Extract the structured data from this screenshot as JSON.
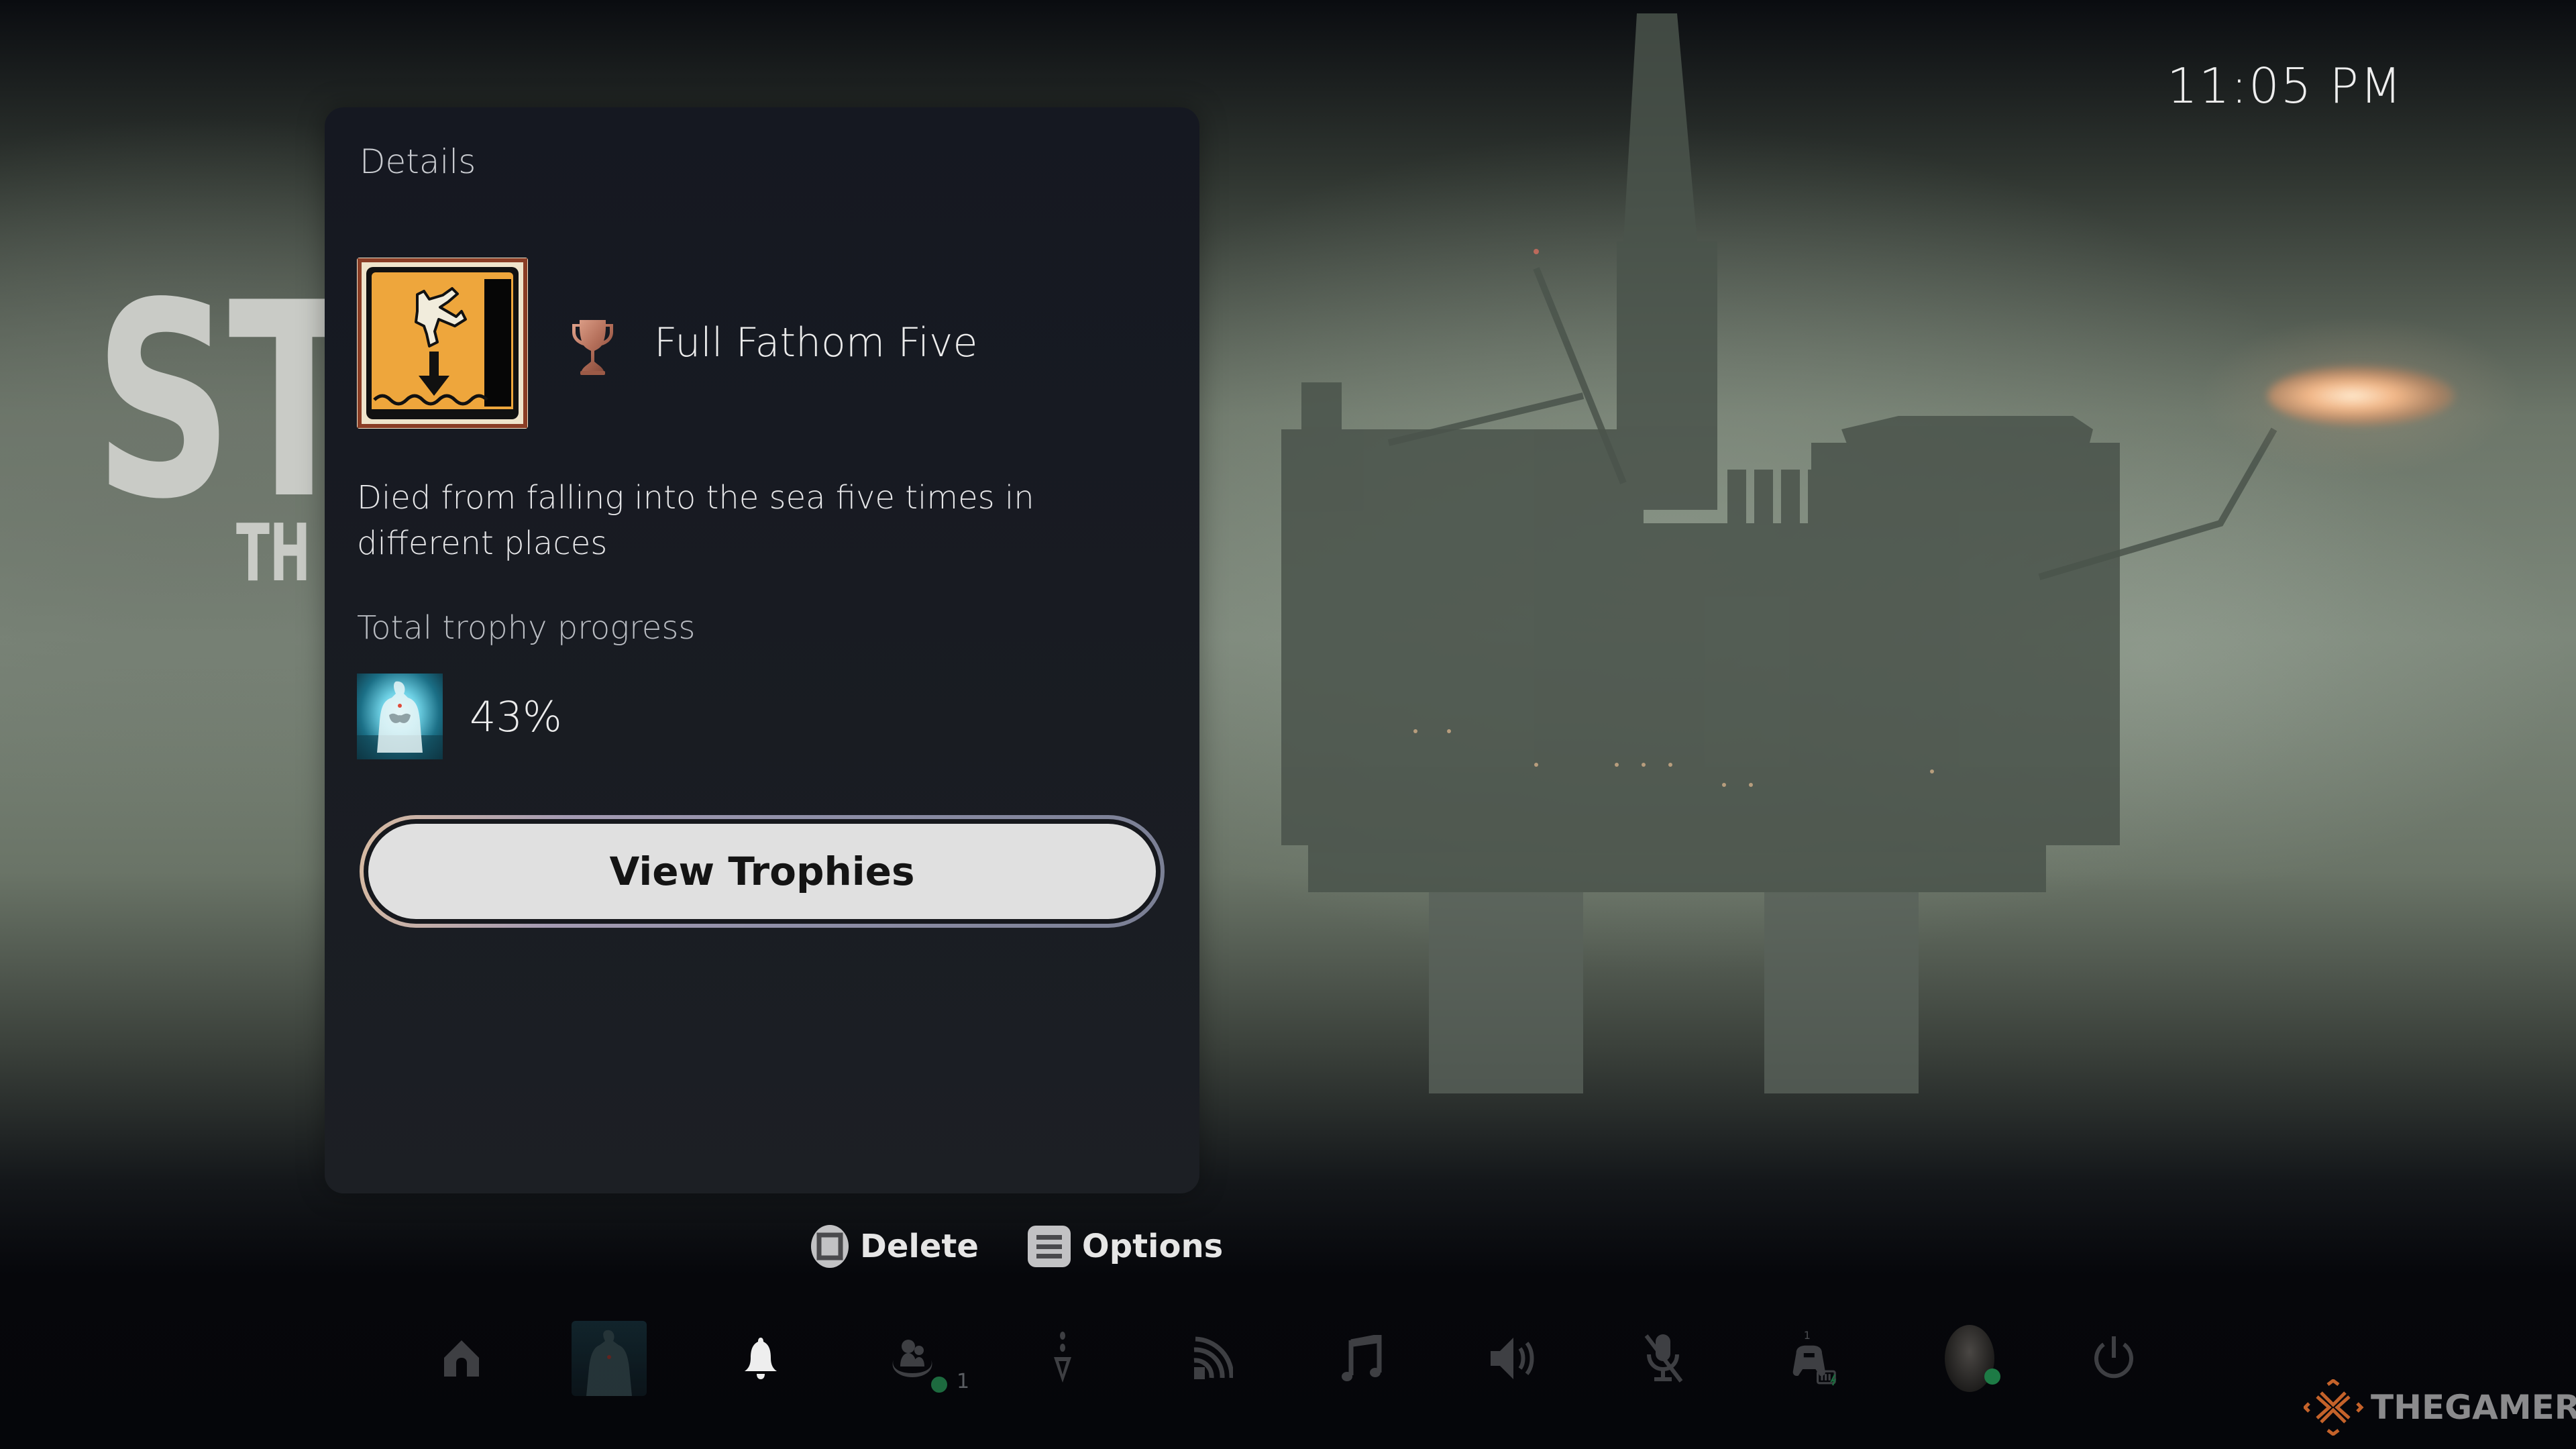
{
  "system": {
    "clock": "11:05 PM"
  },
  "background": {
    "game_logo_line1": "ST",
    "game_logo_line2": "TH"
  },
  "panel": {
    "title": "Details",
    "trophy": {
      "name": "Full Fathom Five",
      "grade": "bronze",
      "grade_color": "#b46f5a",
      "badge_icon": "falling-into-sea-warning-sign",
      "description": "Died from falling into the sea five times in different places"
    },
    "progress": {
      "label": "Total trophy progress",
      "value": "43%",
      "fraction": 0.43,
      "game_icon": "game-cover-thumbnail"
    },
    "primary_button": {
      "label": "View Trophies"
    }
  },
  "hints": [
    {
      "icon": "square-button-icon",
      "label": "Delete"
    },
    {
      "icon": "options-button-icon",
      "label": "Options"
    }
  ],
  "control_center": {
    "items": [
      {
        "icon": "home-icon",
        "name": "home"
      },
      {
        "icon": "game-thumbnail",
        "name": "current-game"
      },
      {
        "icon": "bell-icon",
        "name": "notifications",
        "selected": true
      },
      {
        "icon": "game-base-icon",
        "name": "game-base",
        "badge": "1"
      },
      {
        "icon": "switcher-icon",
        "name": "switcher"
      },
      {
        "icon": "remote-play-icon",
        "name": "remote-play"
      },
      {
        "icon": "music-icon",
        "name": "music"
      },
      {
        "icon": "sound-icon",
        "name": "sound"
      },
      {
        "icon": "mic-muted-icon",
        "name": "mic"
      },
      {
        "icon": "controller-icon",
        "name": "accessories",
        "badge": "1"
      },
      {
        "icon": "avatar",
        "name": "profile"
      },
      {
        "icon": "power-icon",
        "name": "power"
      }
    ],
    "accent_online": "#1d6a3f"
  },
  "watermark": {
    "text": "THEGAMER",
    "accent": "#c4622a"
  }
}
